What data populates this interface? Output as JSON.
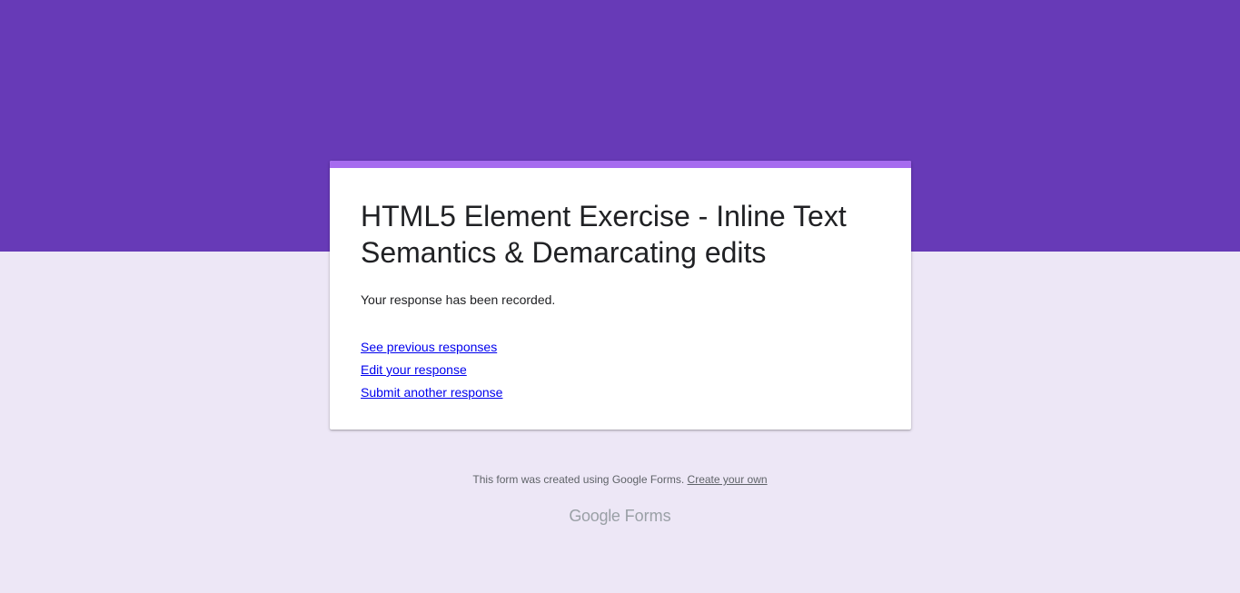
{
  "colors": {
    "header_band": "#673ab7",
    "page_background": "#ede7f6",
    "card_accent": "#a66bef",
    "link": "#0000ee"
  },
  "form": {
    "title": "HTML5 Element Exercise - Inline Text Semantics & Demarcating edits",
    "confirmation_message": "Your response has been recorded."
  },
  "links": {
    "see_previous": "See previous responses",
    "edit_response": "Edit your response",
    "submit_another": "Submit another response"
  },
  "footer": {
    "text": "This form was created using Google Forms.",
    "create_link": "Create your own"
  },
  "brand": {
    "google": "Google",
    "forms": "Forms"
  }
}
